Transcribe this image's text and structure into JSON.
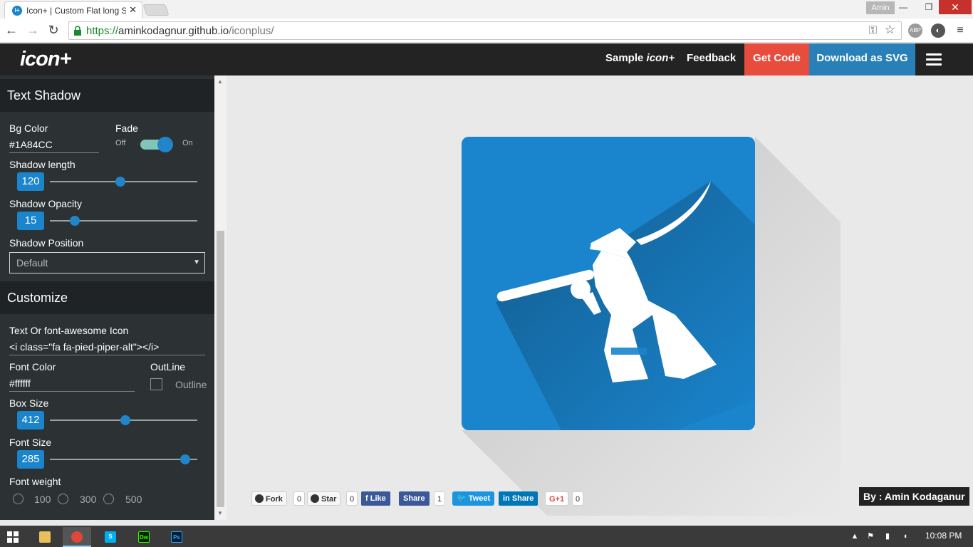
{
  "browser": {
    "tab_title": "Icon+ | Custom Flat long S",
    "favicon_text": "i+",
    "profile_name": "Amin",
    "url_scheme": "https://",
    "url_host": "aminkodagnur.github.io",
    "url_path": "/iconplus/",
    "ext_abp": "ABP"
  },
  "header": {
    "logo": "icon+",
    "nav_sample": "Sample",
    "nav_sample_brand": "icon+",
    "nav_feedback": "Feedback",
    "nav_getcode": "Get Code",
    "nav_download": "Download as SVG"
  },
  "sidebar": {
    "text_shadow": {
      "heading": "Text Shadow",
      "bg_color_label": "Bg Color",
      "bg_color_value": "#1A84CC",
      "fade_label": "Fade",
      "fade_off": "Off",
      "fade_on": "On",
      "fade_enabled": true,
      "shadow_length_label": "Shadow length",
      "shadow_length_value": "120",
      "shadow_length_fraction": 0.48,
      "shadow_opacity_label": "Shadow Opacity",
      "shadow_opacity_value": "15",
      "shadow_opacity_fraction": 0.17,
      "shadow_position_label": "Shadow Position",
      "shadow_position_value": "Default"
    },
    "customize": {
      "heading": "Customize",
      "icon_label": "Text Or font-awesome Icon",
      "icon_value": "<i class=\"fa fa-pied-piper-alt\"></i>",
      "font_color_label": "Font Color",
      "font_color_value": "#ffffff",
      "outline_label": "OutLine",
      "outline_checkbox_label": "Outline",
      "box_size_label": "Box Size",
      "box_size_value": "412",
      "box_size_fraction": 0.51,
      "font_size_label": "Font Size",
      "font_size_value": "285",
      "font_size_fraction": 0.92,
      "font_weight_label": "Font weight",
      "font_weight_options": [
        "100",
        "300",
        "500"
      ]
    }
  },
  "main": {
    "icon_bg_color": "#1a84cc",
    "icon_fg_color": "#ffffff",
    "social": {
      "fork_label": "Fork",
      "fork_count": "0",
      "star_label": "Star",
      "star_count": "0",
      "fb_like": "Like",
      "fb_share": "Share",
      "fb_share_count": "1",
      "tweet": "Tweet",
      "linkedin_share": "Share",
      "gplus": "G+1",
      "gplus_count": "0"
    },
    "byline": "By : Amin Kodaganur"
  },
  "taskbar": {
    "time": "10:08 PM",
    "apps": [
      "file-explorer",
      "chrome",
      "skype",
      "dreamweaver",
      "photoshop"
    ],
    "dw_label": "Dw",
    "ps_label": "Ps",
    "skype_label": "S"
  }
}
